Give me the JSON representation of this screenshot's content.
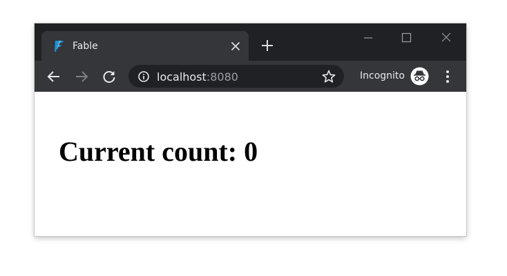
{
  "window": {
    "tab": {
      "title": "Fable",
      "icon": "fable-logo-icon"
    },
    "controls": [
      "minimize-icon",
      "maximize-icon",
      "close-icon"
    ]
  },
  "toolbar": {
    "back_icon": "back-arrow-icon",
    "forward_icon": "forward-arrow-icon",
    "reload_icon": "reload-icon",
    "url": {
      "host": "localhost",
      "port": ":8080"
    },
    "incognito_label": "Incognito"
  },
  "page": {
    "heading": "Current count: 0"
  },
  "colors": {
    "titlebar": "#202124",
    "toolbar": "#35363a",
    "tab_icon": "#1e90d6"
  }
}
